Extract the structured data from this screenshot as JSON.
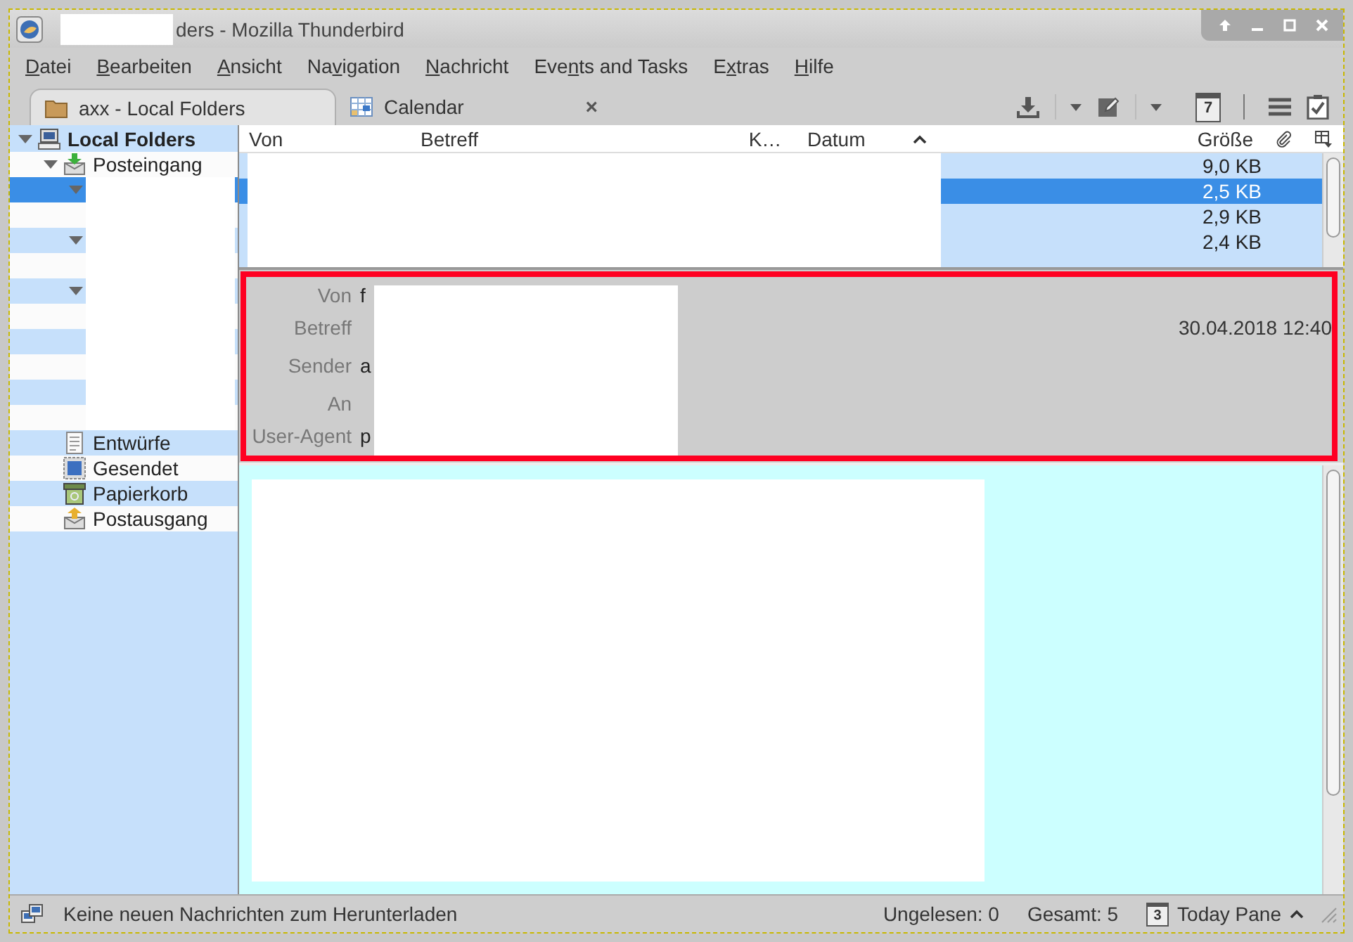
{
  "window": {
    "title": "ders - Mozilla Thunderbird"
  },
  "menu": [
    {
      "key": "D",
      "after": "atei"
    },
    {
      "key": "B",
      "after": "earbeiten"
    },
    {
      "key": "A",
      "after": "nsicht"
    },
    {
      "before": "Na",
      "key": "v",
      "after": "igation"
    },
    {
      "key": "N",
      "after": "achricht"
    },
    {
      "before": "Eve",
      "key": "n",
      "after": "ts and Tasks"
    },
    {
      "before": "E",
      "key": "x",
      "after": "tras"
    },
    {
      "key": "H",
      "after": "ilfe"
    }
  ],
  "tabs": [
    {
      "label": "axx - Local Folders",
      "kind": "folder",
      "selected": true,
      "closable": false
    },
    {
      "label": "Calendar",
      "kind": "calendar",
      "selected": false,
      "closable": true
    }
  ],
  "toolbar": {
    "calendar_day": "7",
    "close_glyph": "×"
  },
  "sidebar": {
    "folders": [
      {
        "name": "Local Folders",
        "kind": "server",
        "expanded": true,
        "selected": false,
        "children": [
          {
            "name": "Posteingang",
            "kind": "inbox",
            "expanded": true,
            "selected": false,
            "children": [
              {
                "expanded": true,
                "selected": true
              },
              {
                "selected": false
              },
              {
                "expanded": true,
                "selected": false
              },
              {
                "selected": false
              },
              {
                "expanded": true,
                "selected": false
              },
              {
                "selected": false
              },
              {
                "selected": false
              },
              {
                "selected": false
              },
              {
                "selected": false
              },
              {
                "selected": false
              }
            ]
          },
          {
            "name": "Entwürfe",
            "kind": "drafts",
            "selected": false
          },
          {
            "name": "Gesendet",
            "kind": "sent",
            "selected": false
          },
          {
            "name": "Papierkorb",
            "kind": "trash",
            "selected": false
          },
          {
            "name": "Postausgang",
            "kind": "outbox",
            "selected": false
          }
        ]
      }
    ]
  },
  "message_list": {
    "columns": [
      {
        "label": "Von",
        "sorted": false
      },
      {
        "label": "Betreff",
        "sorted": false
      },
      {
        "label": "K…",
        "sorted": false
      },
      {
        "label": "Datum",
        "sorted": true
      },
      {
        "label": "Größe",
        "sorted": false
      }
    ],
    "rows": [
      {
        "size": "9,0 KB",
        "selected": false
      },
      {
        "size": "2,5 KB",
        "selected": true
      },
      {
        "size": "2,9 KB",
        "selected": false
      },
      {
        "size": "2,4 KB",
        "selected": false
      },
      {
        "selected": false
      }
    ]
  },
  "header": {
    "date": "30.04.2018 12:40",
    "fields": [
      {
        "label": "Von",
        "value": "f"
      },
      {
        "label": "Betreff"
      },
      {
        "label": "Sender",
        "value": "a"
      },
      {
        "label": "An"
      },
      {
        "label": "User-Agent",
        "value": "p"
      }
    ]
  },
  "status_bar": {
    "message": "Keine neuen Nachrichten zum Herunterladen",
    "unread": "Ungelesen: 0",
    "total": "Gesamt: 5",
    "today_day": "3",
    "today_label": "Today Pane"
  }
}
